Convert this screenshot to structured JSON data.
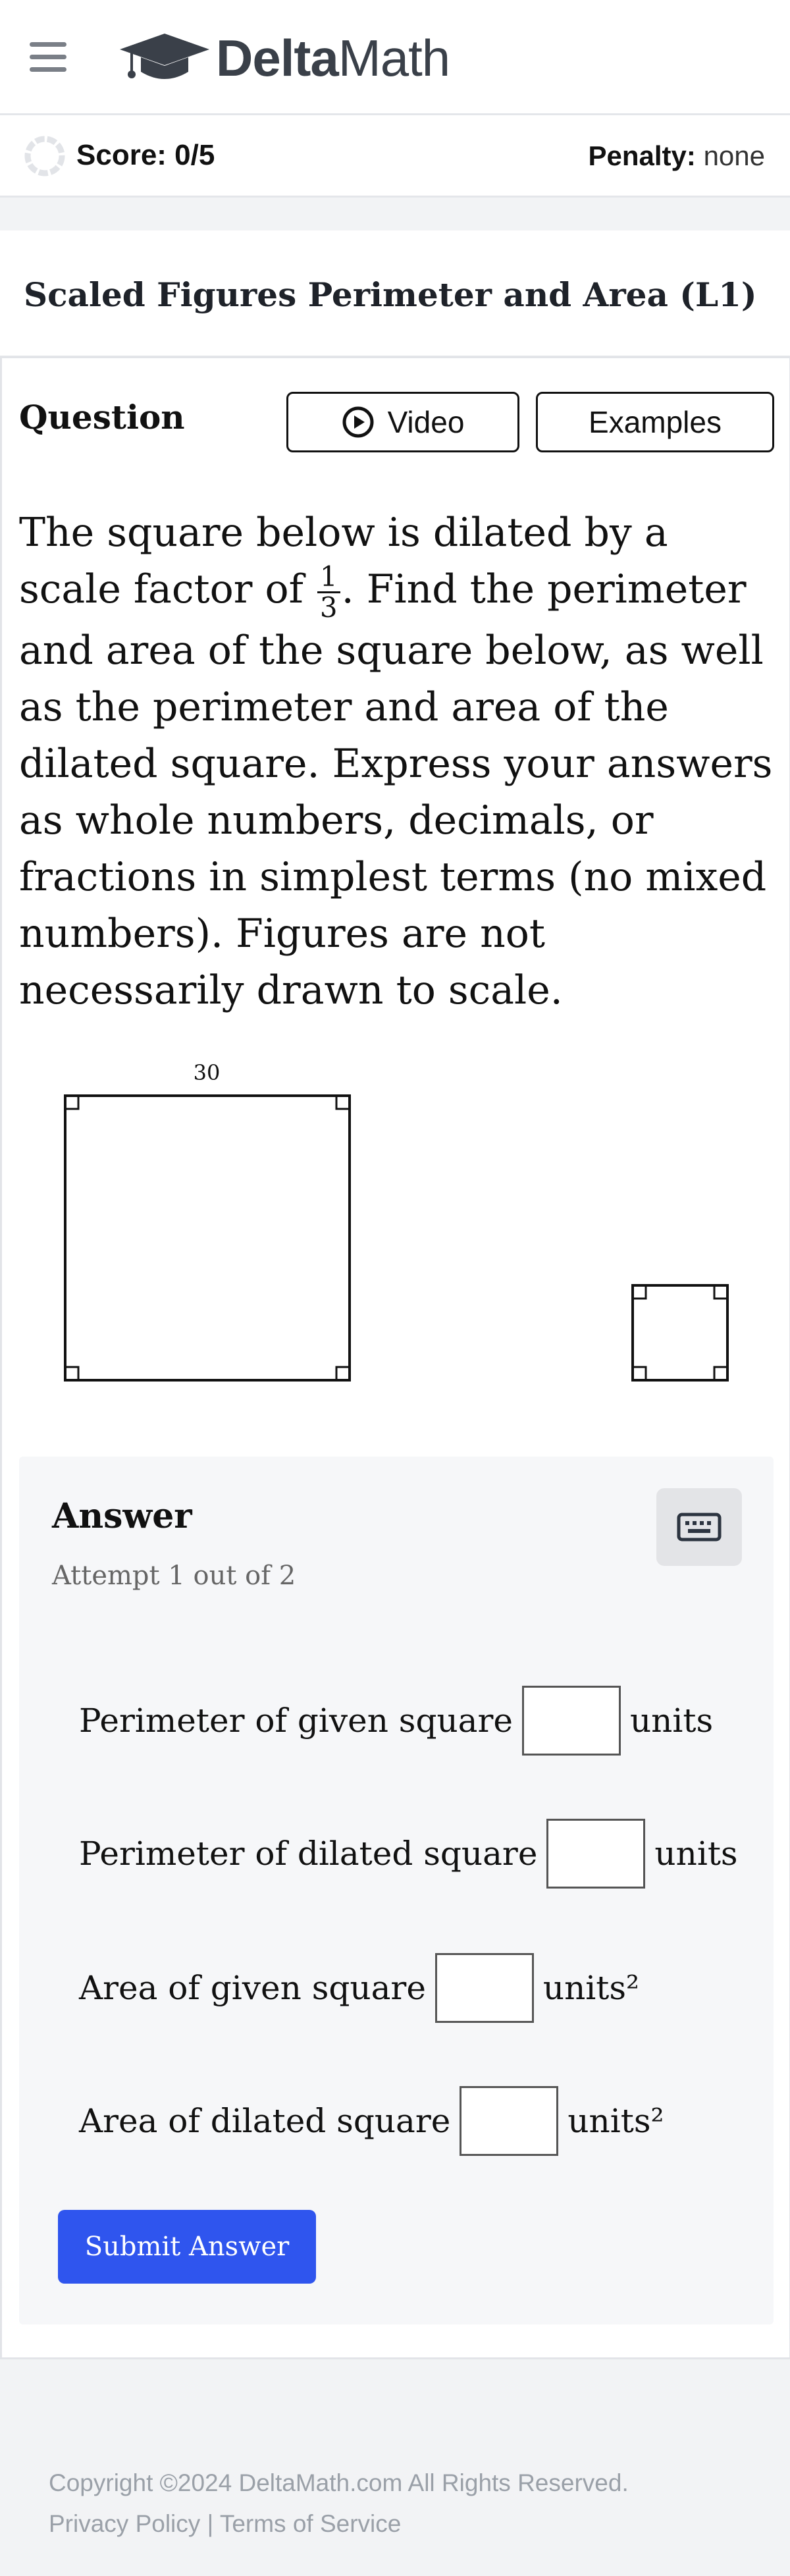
{
  "header": {
    "menu_icon": "hamburger-icon",
    "logo_icon": "graduation-cap-icon",
    "logo_bold": "Delta",
    "logo_regular": "Math"
  },
  "scorebar": {
    "score": "Score: 0/5",
    "penalty_label": "Penalty:",
    "penalty_value": "none"
  },
  "assignment": {
    "title": "Scaled Figures Perimeter and Area (L1)"
  },
  "question": {
    "label": "Question",
    "video_button": "Video",
    "examples_button": "Examples",
    "prompt_before": "The square below is dilated by a scale factor of ",
    "scale_numerator": "1",
    "scale_denominator": "3",
    "prompt_after": ". Find the perimeter and area of the square below, as well as the perimeter and area of the dilated square. Express your answers as whole numbers, decimals, or fractions in simplest terms (no mixed numbers). Figures are not necessarily drawn to scale.",
    "side_label": "30"
  },
  "answer": {
    "title": "Answer",
    "attempt": "Attempt 1 out of 2",
    "keyboard_icon": "keyboard-icon",
    "rows": [
      {
        "label": "Perimeter of given square",
        "unit": "units",
        "value": ""
      },
      {
        "label": "Perimeter of dilated square",
        "unit": "units",
        "value": ""
      },
      {
        "label": "Area of given square",
        "unit": "units²",
        "value": ""
      },
      {
        "label": "Area of dilated square",
        "unit": "units²",
        "value": ""
      }
    ],
    "submit": "Submit Answer"
  },
  "footer": {
    "copyright": "Copyright ©2024 DeltaMath.com All Rights Reserved.",
    "privacy": "Privacy Policy",
    "separator": "|",
    "terms": "Terms of Service"
  },
  "colors": {
    "primary": "#2f55ee",
    "logo_text": "#3a4049",
    "footer_text": "#9aa0a8"
  }
}
